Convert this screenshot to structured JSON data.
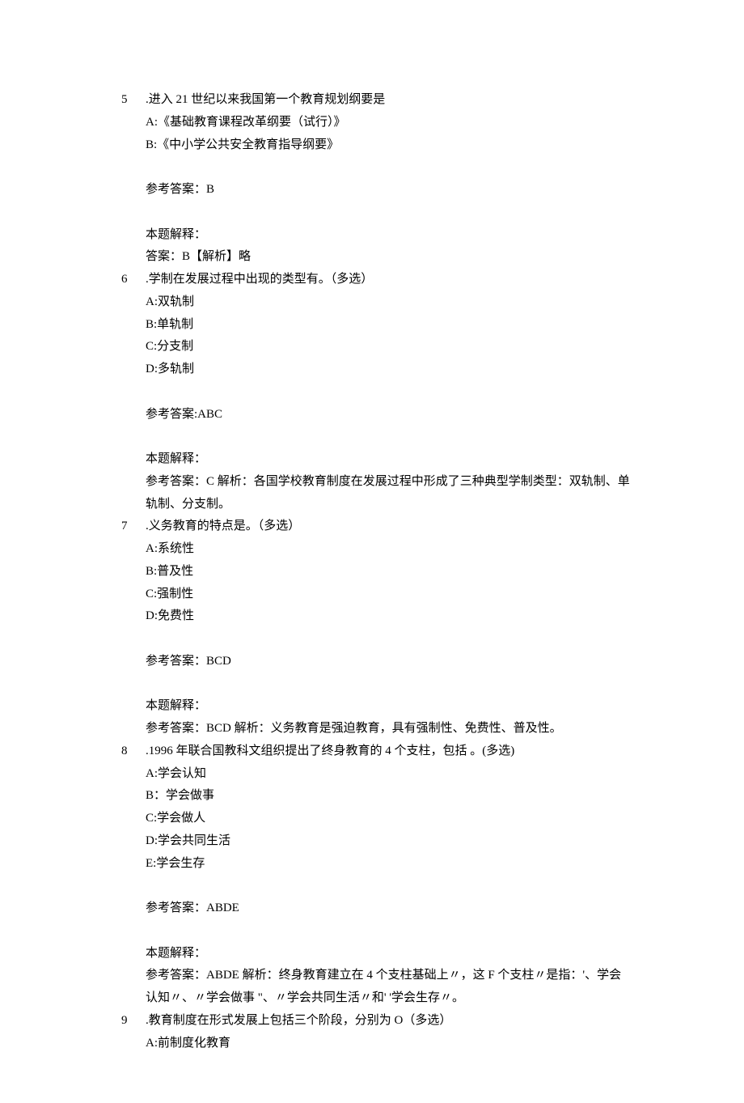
{
  "questions": [
    {
      "num": "5",
      "stem": ".进入 21 世纪以来我国第一个教育规划纲要是",
      "options": [
        "A:《基础教育课程改革纲要（试行）》",
        "B:《中小学公共安全教育指导纲要》"
      ],
      "answerLabel": "参考答案：B",
      "explainLabel": "本题解释：",
      "explainText": "答案：B【解析】略"
    },
    {
      "num": "6",
      "stem": ".学制在发展过程中出现的类型有。（多选）",
      "options": [
        "A:双轨制",
        "B:单轨制",
        "C:分支制",
        "D:多轨制"
      ],
      "answerLabel": "参考答案:ABC",
      "explainLabel": "本题解释：",
      "explainText": "参考答案：C 解析：各国学校教育制度在发展过程中形成了三种典型学制类型：双轨制、单轨制、分支制。"
    },
    {
      "num": "7",
      "stem": ".义务教育的特点是。（多选）",
      "options": [
        "A:系统性",
        "B:普及性",
        "C:强制性",
        "D:免费性"
      ],
      "answerLabel": "参考答案：BCD",
      "explainLabel": "本题解释：",
      "explainText": "参考答案：BCD 解析：义务教育是强迫教育，具有强制性、免费性、普及性。"
    },
    {
      "num": "8",
      "stem": ".1996 年联合国教科文组织提出了终身教育的 4 个支柱，包括 。(多选)",
      "options": [
        "A:学会认知",
        "B：学会做事",
        "C:学会做人",
        "D:学会共同生活",
        "E:学会生存"
      ],
      "answerLabel": "参考答案：ABDE",
      "explainLabel": "本题解释：",
      "explainText": "参考答案：ABDE 解析：终身教育建立在 4 个支柱基础上〃，这 F 个支柱〃是指：'、学会认知〃、〃学会做事 \"、〃学会共同生活〃和' '学会生存〃。"
    },
    {
      "num": "9",
      "stem": ".教育制度在形式发展上包括三个阶段，分别为 O（多选）",
      "options": [
        "A:前制度化教育"
      ],
      "answerLabel": "",
      "explainLabel": "",
      "explainText": ""
    }
  ]
}
